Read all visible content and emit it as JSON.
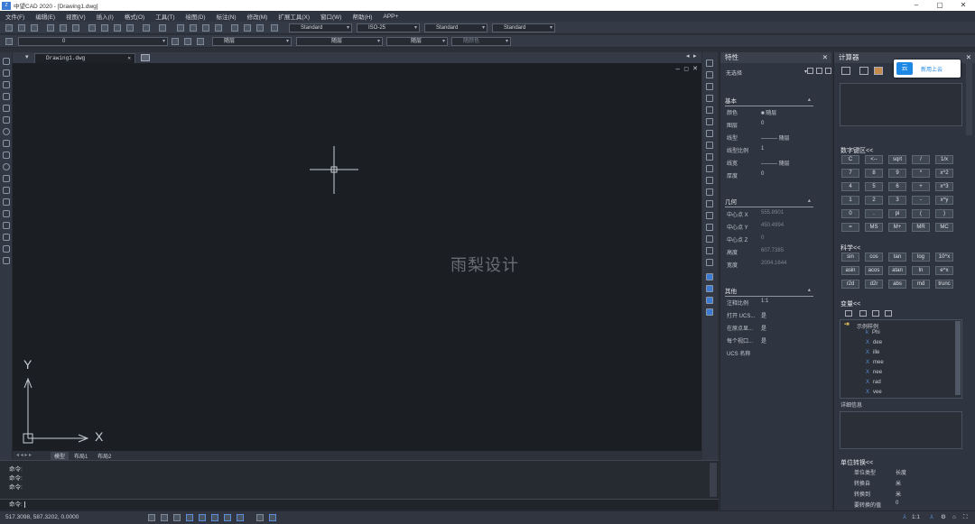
{
  "window": {
    "title": "中望CAD 2020 - [Drawing1.dwg]",
    "min": "–",
    "restore": "▢",
    "close": "✕"
  },
  "menu": [
    "文件(F)",
    "编辑(E)",
    "视图(V)",
    "插入(I)",
    "格式(O)",
    "工具(T)",
    "绘图(D)",
    "标注(N)",
    "修改(M)",
    "扩展工具(X)",
    "窗口(W)",
    "帮助(H)",
    "APP+"
  ],
  "toolbar": {
    "text_style": "Standard",
    "dim_style": "ISO-25",
    "table_style": "Standard",
    "multileader_style": "Standard",
    "layer": "0",
    "color": "随层",
    "linetype": "随层",
    "lineweight": "随层",
    "plot_style": "随颜色"
  },
  "drawing_tab": "Drawing1.dwg",
  "watermark": "雨梨设计",
  "ucs": {
    "y": "Y",
    "x": "X"
  },
  "layout_tabs": [
    "模型",
    "布局1",
    "布局2"
  ],
  "command": {
    "lines": [
      "命令:",
      "命令:",
      "命令:"
    ],
    "prompt": "命令:"
  },
  "status": {
    "coords": "517.3098, 587.3202, 0.0000",
    "scale": "1:1"
  },
  "properties": {
    "title": "特性",
    "selection": "无选择",
    "sections": {
      "basic": "基本",
      "geometry": "几何",
      "misc": "其他"
    },
    "basic": [
      {
        "label": "颜色",
        "value": "■ 随层"
      },
      {
        "label": "图层",
        "value": "0"
      },
      {
        "label": "线型",
        "value": "——— 随层"
      },
      {
        "label": "线型比例",
        "value": "1"
      },
      {
        "label": "线宽",
        "value": "——— 随层"
      },
      {
        "label": "厚度",
        "value": "0"
      }
    ],
    "geometry": [
      {
        "label": "中心点 X",
        "value": "555.8901"
      },
      {
        "label": "中心点 Y",
        "value": "450.4994"
      },
      {
        "label": "中心点 Z",
        "value": "0"
      },
      {
        "label": "高度",
        "value": "607.7385"
      },
      {
        "label": "宽度",
        "value": "2004.1644"
      }
    ],
    "misc": [
      {
        "label": "注释比例",
        "value": "1:1"
      },
      {
        "label": "打开 UCS...",
        "value": "是"
      },
      {
        "label": "在原点显...",
        "value": "是"
      },
      {
        "label": "每个视口...",
        "value": "是"
      },
      {
        "label": "UCS 名称",
        "value": ""
      }
    ]
  },
  "calculator": {
    "title": "计算器",
    "cloud_label": "新用上云",
    "cloud_icon": "云",
    "numpad_title": "数字键区<<",
    "numpad": [
      [
        "C",
        "<--",
        "sqrt",
        "/",
        "1/x"
      ],
      [
        "7",
        "8",
        "9",
        "*",
        "x^2"
      ],
      [
        "4",
        "5",
        "6",
        "+",
        "x^3"
      ],
      [
        "1",
        "2",
        "3",
        "-",
        "x^y"
      ],
      [
        "0",
        ".",
        "pi",
        "(",
        ")"
      ],
      [
        "=",
        "MS",
        "M+",
        "MR",
        "MC"
      ]
    ],
    "sci_title": "科学<<",
    "sci": [
      [
        "sin",
        "cos",
        "tan",
        "log",
        "10^x"
      ],
      [
        "asin",
        "acos",
        "atan",
        "ln",
        "e^x"
      ],
      [
        "r2d",
        "d2r",
        "abs",
        "rnd",
        "trunc"
      ]
    ],
    "var_title": "变量<<",
    "var_folder": "示例样例",
    "variables": [
      {
        "icon": "k",
        "name": "Phi"
      },
      {
        "icon": "X",
        "name": "dee"
      },
      {
        "icon": "X",
        "name": "ille"
      },
      {
        "icon": "X",
        "name": "mee"
      },
      {
        "icon": "X",
        "name": "nee"
      },
      {
        "icon": "X",
        "name": "rad"
      },
      {
        "icon": "X",
        "name": "vee"
      }
    ],
    "details_label": "详细信息",
    "unit_title": "单位转换<<",
    "units": [
      {
        "label": "单位类型",
        "value": "长度"
      },
      {
        "label": "转换自",
        "value": "米"
      },
      {
        "label": "转换到",
        "value": "米"
      },
      {
        "label": "要转换的值",
        "value": "0"
      }
    ]
  },
  "colors": {
    "canvas": "#1b1f24",
    "panel": "#2f3540",
    "accent": "#3b7bd4"
  }
}
